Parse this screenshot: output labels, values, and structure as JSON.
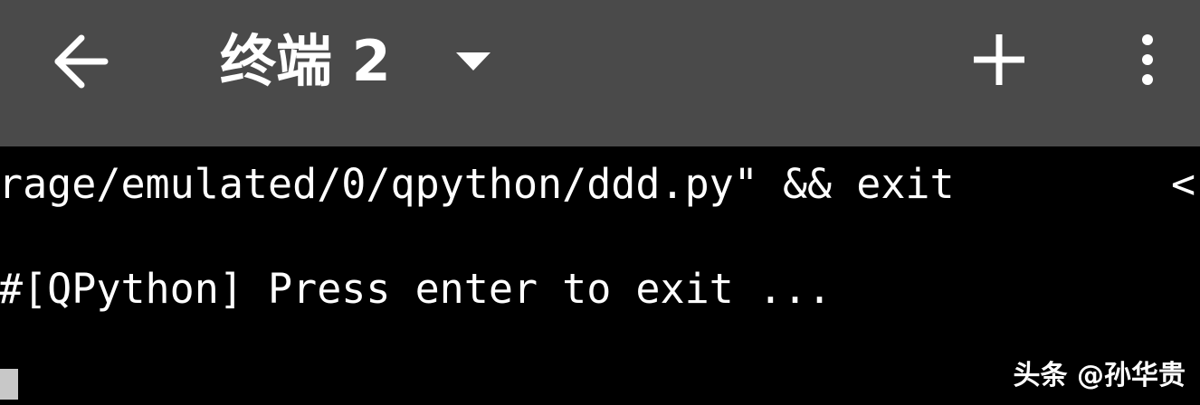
{
  "toolbar": {
    "back_icon": "arrow-left-icon",
    "title": "终端 2",
    "dropdown_icon": "caret-down-icon",
    "add_icon": "plus-icon",
    "more_icon": "more-vertical-icon",
    "background_color": "#4a4a4a",
    "icon_color": "#ffffff"
  },
  "terminal": {
    "background_color": "#000000",
    "text_color": "#ffffff",
    "lines": [
      "rage/emulated/0/qpython/ddd.py\" && exit",
      "#[QPython] Press enter to exit ..."
    ],
    "overflow_marker": "<",
    "cursor_color": "#c8c8c8"
  },
  "watermark": {
    "text": "头条 @孙华贵"
  }
}
